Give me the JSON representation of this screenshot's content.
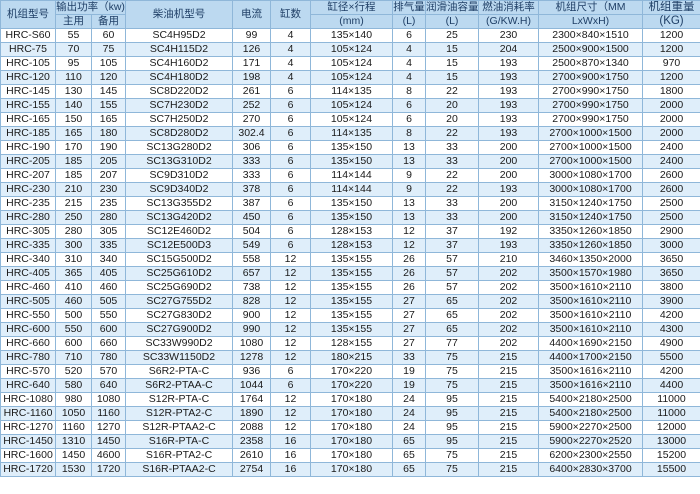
{
  "header": {
    "model": "机组型号",
    "power": "输出功率（kw)",
    "main": "主用",
    "standby": "备用",
    "engine": "柴油机型号",
    "current": "电流",
    "cylinders": "缸数",
    "bore_stroke": "缸径×行程",
    "bore_unit": "(mm)",
    "displacement": "排气量",
    "displacement_unit": "(L)",
    "oil_capacity": "润滑油容量",
    "oil_unit": "(L)",
    "fuel": "燃油消耗率",
    "fuel_unit": "(G/KW.H)",
    "dimensions": "机组尺寸（MM",
    "dimensions_unit": "LxWxH)",
    "weight": "机组重量",
    "weight_unit": "(KG)"
  },
  "rows": [
    [
      "HRC-S60",
      "55",
      "60",
      "SC4H95D2",
      "99",
      "4",
      "135×140",
      "6",
      "25",
      "230",
      "2300×840×1510",
      "1200"
    ],
    [
      "HRC-75",
      "70",
      "75",
      "SC4H115D2",
      "126",
      "4",
      "105×124",
      "4",
      "15",
      "204",
      "2500×900×1500",
      "1200"
    ],
    [
      "HRC-105",
      "95",
      "105",
      "SC4H160D2",
      "171",
      "4",
      "105×124",
      "4",
      "15",
      "193",
      "2500×870×1340",
      "970"
    ],
    [
      "HRC-120",
      "110",
      "120",
      "SC4H180D2",
      "198",
      "4",
      "105×124",
      "4",
      "15",
      "193",
      "2700×900×1750",
      "1200"
    ],
    [
      "HRC-145",
      "130",
      "145",
      "SC8D220D2",
      "261",
      "6",
      "114×135",
      "8",
      "22",
      "193",
      "2700×990×1750",
      "1800"
    ],
    [
      "HRC-155",
      "140",
      "155",
      "SC7H230D2",
      "252",
      "6",
      "105×124",
      "6",
      "20",
      "193",
      "2700×990×1750",
      "2000"
    ],
    [
      "HRC-165",
      "150",
      "165",
      "SC7H250D2",
      "270",
      "6",
      "105×124",
      "6",
      "20",
      "193",
      "2700×990×1750",
      "2000"
    ],
    [
      "HRC-185",
      "165",
      "180",
      "SC8D280D2",
      "302.4",
      "6",
      "114×135",
      "8",
      "22",
      "193",
      "2700×1000×1500",
      "2000"
    ],
    [
      "HRC-190",
      "170",
      "190",
      "SC13G280D2",
      "306",
      "6",
      "135×150",
      "13",
      "33",
      "200",
      "2700×1000×1500",
      "2400"
    ],
    [
      "HRC-205",
      "185",
      "205",
      "SC13G310D2",
      "333",
      "6",
      "135×150",
      "13",
      "33",
      "200",
      "2700×1000×1500",
      "2400"
    ],
    [
      "HRC-207",
      "185",
      "207",
      "SC9D310D2",
      "333",
      "6",
      "114×144",
      "9",
      "22",
      "200",
      "3000×1080×1700",
      "2600"
    ],
    [
      "HRC-230",
      "210",
      "230",
      "SC9D340D2",
      "378",
      "6",
      "114×144",
      "9",
      "22",
      "193",
      "3000×1080×1700",
      "2600"
    ],
    [
      "HRC-235",
      "215",
      "235",
      "SC13G355D2",
      "387",
      "6",
      "135×150",
      "13",
      "33",
      "200",
      "3150×1240×1750",
      "2500"
    ],
    [
      "HRC-280",
      "250",
      "280",
      "SC13G420D2",
      "450",
      "6",
      "135×150",
      "13",
      "33",
      "200",
      "3150×1240×1750",
      "2500"
    ],
    [
      "HRC-305",
      "280",
      "305",
      "SC12E460D2",
      "504",
      "6",
      "128×153",
      "12",
      "37",
      "192",
      "3350×1260×1850",
      "2900"
    ],
    [
      "HRC-335",
      "300",
      "335",
      "SC12E500D3",
      "549",
      "6",
      "128×153",
      "12",
      "37",
      "193",
      "3350×1260×1850",
      "3000"
    ],
    [
      "HRC-340",
      "310",
      "340",
      "SC15G500D2",
      "558",
      "12",
      "135×155",
      "26",
      "57",
      "210",
      "3460×1350×2000",
      "3650"
    ],
    [
      "HRC-405",
      "365",
      "405",
      "SC25G610D2",
      "657",
      "12",
      "135×155",
      "26",
      "57",
      "202",
      "3500×1570×1980",
      "3650"
    ],
    [
      "HRC-460",
      "410",
      "460",
      "SC25G690D2",
      "738",
      "12",
      "135×155",
      "26",
      "57",
      "202",
      "3500×1610×2110",
      "3800"
    ],
    [
      "HRC-505",
      "460",
      "505",
      "SC27G755D2",
      "828",
      "12",
      "135×155",
      "27",
      "65",
      "202",
      "3500×1610×2110",
      "3900"
    ],
    [
      "HRC-550",
      "500",
      "550",
      "SC27G830D2",
      "900",
      "12",
      "135×155",
      "27",
      "65",
      "202",
      "3500×1610×2110",
      "4200"
    ],
    [
      "HRC-600",
      "550",
      "600",
      "SC27G900D2",
      "990",
      "12",
      "135×155",
      "27",
      "65",
      "202",
      "3500×1610×2110",
      "4300"
    ],
    [
      "HRC-660",
      "600",
      "660",
      "SC33W990D2",
      "1080",
      "12",
      "128×155",
      "27",
      "77",
      "202",
      "4400×1690×2150",
      "4900"
    ],
    [
      "HRC-780",
      "710",
      "780",
      "SC33W1150D2",
      "1278",
      "12",
      "180×215",
      "33",
      "75",
      "215",
      "4400×1700×2150",
      "5500"
    ],
    [
      "HRC-570",
      "520",
      "570",
      "S6R2-PTA-C",
      "936",
      "6",
      "170×220",
      "19",
      "75",
      "215",
      "3500×1616×2110",
      "4200"
    ],
    [
      "HRC-640",
      "580",
      "640",
      "S6R2-PTAA-C",
      "1044",
      "6",
      "170×220",
      "19",
      "75",
      "215",
      "3500×1616×2110",
      "4400"
    ],
    [
      "HRC-1080",
      "980",
      "1080",
      "S12R-PTA-C",
      "1764",
      "12",
      "170×180",
      "24",
      "95",
      "215",
      "5400×2180×2500",
      "11000"
    ],
    [
      "HRC-1160",
      "1050",
      "1160",
      "S12R-PTA2-C",
      "1890",
      "12",
      "170×180",
      "24",
      "95",
      "215",
      "5400×2180×2500",
      "11000"
    ],
    [
      "HRC-1270",
      "1160",
      "1270",
      "S12R-PTAA2-C",
      "2088",
      "12",
      "170×180",
      "24",
      "95",
      "215",
      "5900×2270×2500",
      "12000"
    ],
    [
      "HRC-1450",
      "1310",
      "1450",
      "S16R-PTA-C",
      "2358",
      "16",
      "170×180",
      "65",
      "95",
      "215",
      "5900×2270×2520",
      "13000"
    ],
    [
      "HRC-1600",
      "1450",
      "4600",
      "S16R-PTA2-C",
      "2610",
      "16",
      "170×180",
      "65",
      "75",
      "215",
      "6200×2300×2550",
      "15200"
    ],
    [
      "HRC-1720",
      "1530",
      "1720",
      "S16R-PTAA2-C",
      "2754",
      "16",
      "170×180",
      "65",
      "75",
      "215",
      "6400×2830×3700",
      "15500"
    ]
  ]
}
